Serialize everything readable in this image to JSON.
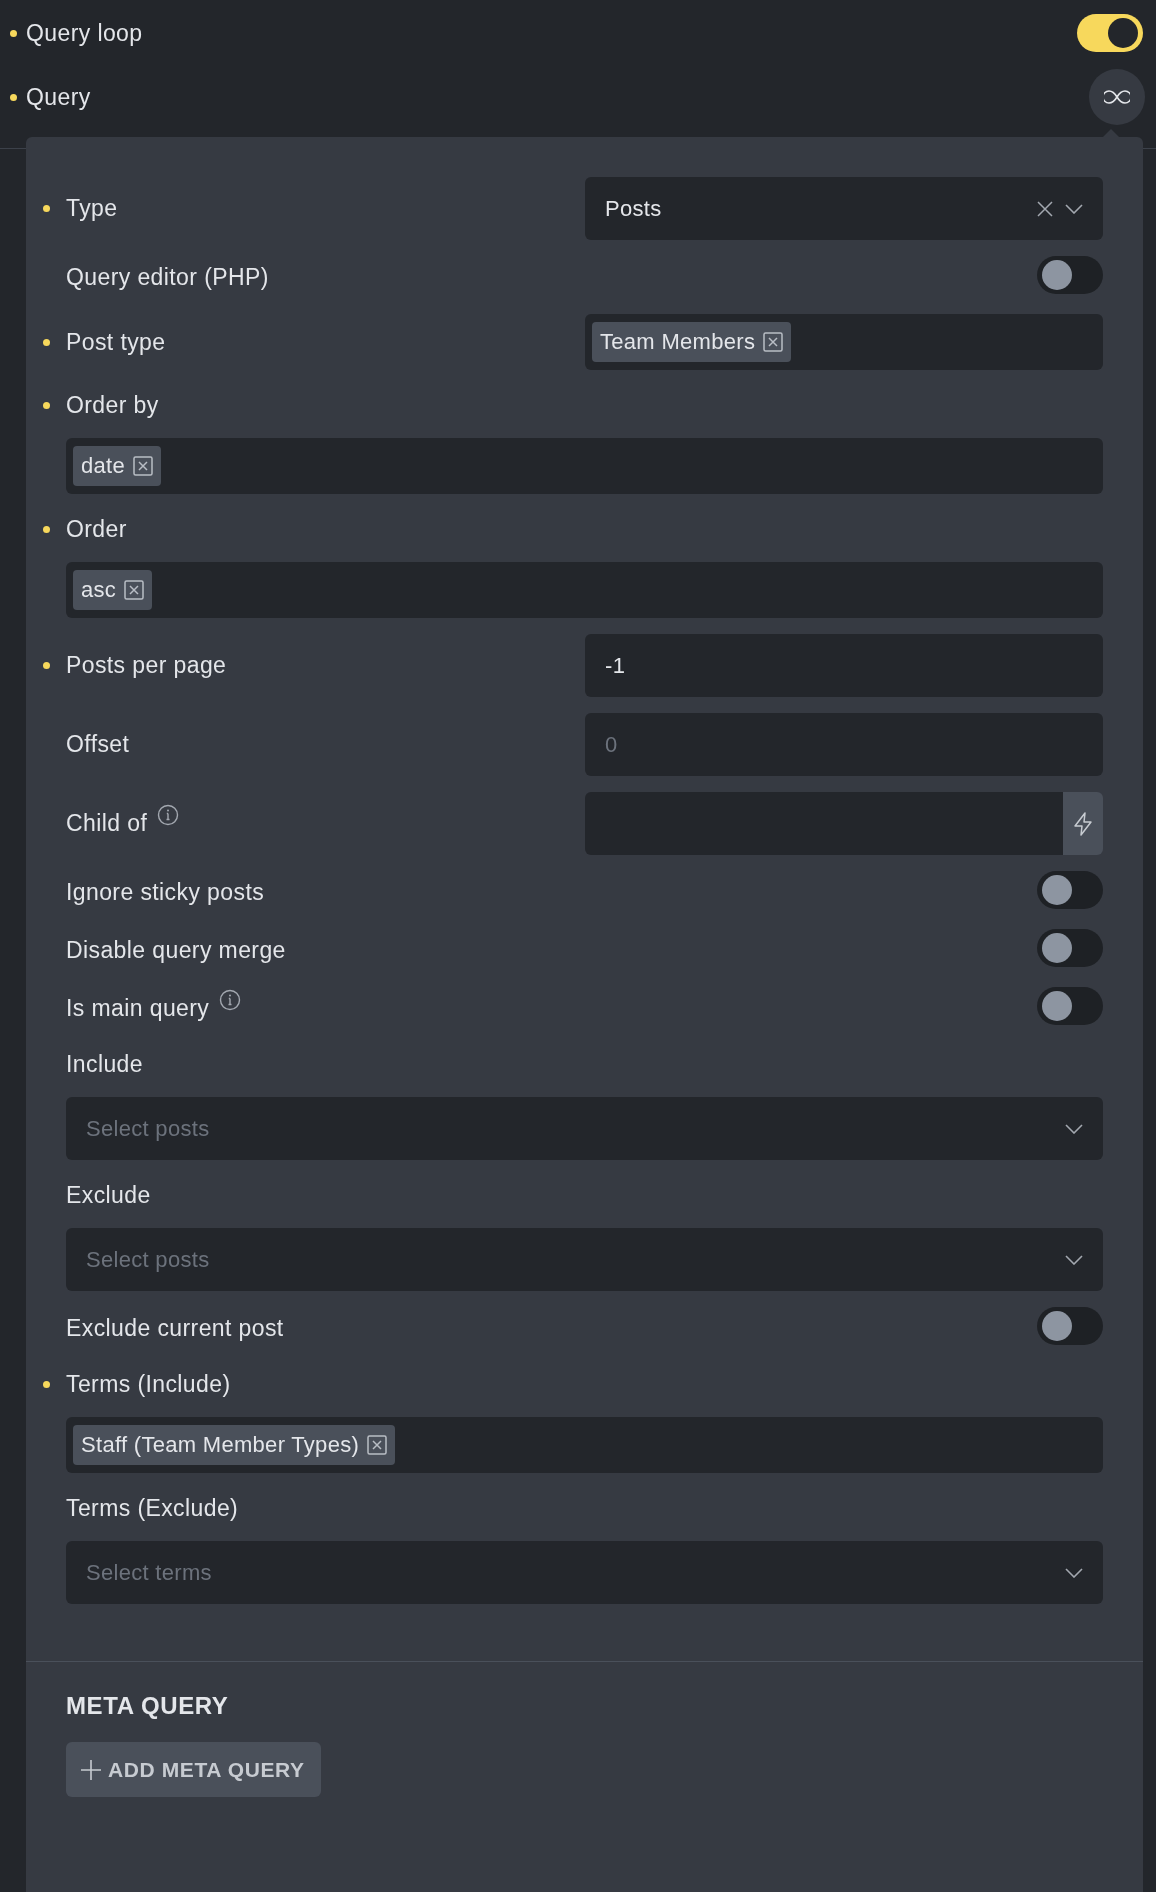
{
  "header": [
    {
      "kind": "toggle",
      "label": "Query loop",
      "marked": true,
      "on": true
    },
    {
      "kind": "loop-button",
      "label": "Query",
      "marked": true
    }
  ],
  "panel": {
    "fields": [
      {
        "kind": "select",
        "label": "Type",
        "marked": true,
        "value": "Posts"
      },
      {
        "kind": "toggle",
        "label": "Query editor (PHP)",
        "marked": false,
        "on": false
      },
      {
        "kind": "tags",
        "label": "Post type",
        "marked": true,
        "tags": [
          "Team Members"
        ]
      },
      {
        "kind": "tags-block",
        "label": "Order by",
        "marked": true,
        "tags": [
          "date"
        ]
      },
      {
        "kind": "tags-block",
        "label": "Order",
        "marked": true,
        "tags": [
          "asc"
        ]
      },
      {
        "kind": "text",
        "label": "Posts per page",
        "marked": true,
        "value": "-1"
      },
      {
        "kind": "text",
        "label": "Offset",
        "marked": false,
        "placeholder": "0"
      },
      {
        "kind": "dynamic",
        "label": "Child of",
        "marked": false,
        "info": true
      },
      {
        "kind": "toggle",
        "label": "Ignore sticky posts",
        "marked": false,
        "on": false
      },
      {
        "kind": "toggle",
        "label": "Disable query merge",
        "marked": false,
        "on": false
      },
      {
        "kind": "toggle",
        "label": "Is main query",
        "marked": false,
        "on": false,
        "info": true
      },
      {
        "kind": "select-block",
        "label": "Include",
        "marked": false,
        "placeholder": "Select posts"
      },
      {
        "kind": "select-block",
        "label": "Exclude",
        "marked": false,
        "placeholder": "Select posts"
      },
      {
        "kind": "toggle",
        "label": "Exclude current post",
        "marked": false,
        "on": false
      },
      {
        "kind": "tags-block",
        "label": "Terms (Include)",
        "marked": true,
        "tags": [
          "Staff (Team Member Types)"
        ]
      },
      {
        "kind": "select-block",
        "label": "Terms (Exclude)",
        "marked": false,
        "placeholder": "Select terms"
      }
    ],
    "meta": {
      "heading": "META QUERY",
      "button": "ADD META QUERY"
    }
  }
}
